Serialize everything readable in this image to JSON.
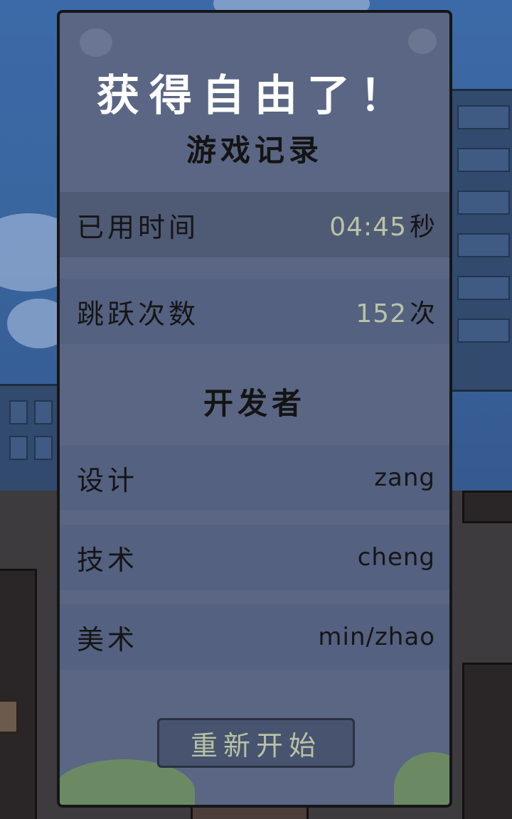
{
  "header": {
    "title": "获得自由了！"
  },
  "game_record": {
    "heading": "游戏记录",
    "time_label": "已用时间",
    "time_value": "04:45",
    "time_unit": "秒",
    "jumps_label": "跳跃次数",
    "jumps_value": "152",
    "jumps_unit": "次"
  },
  "developers": {
    "heading": "开发者",
    "items": [
      {
        "role": "设计",
        "name": "zang"
      },
      {
        "role": "技术",
        "name": "cheng"
      },
      {
        "role": "美术",
        "name": "min/zhao"
      }
    ]
  },
  "actions": {
    "restart_label": "重新开始"
  },
  "colors": {
    "panel": "#5a6684",
    "value_text": "#b9c3a6",
    "border": "#151617"
  }
}
